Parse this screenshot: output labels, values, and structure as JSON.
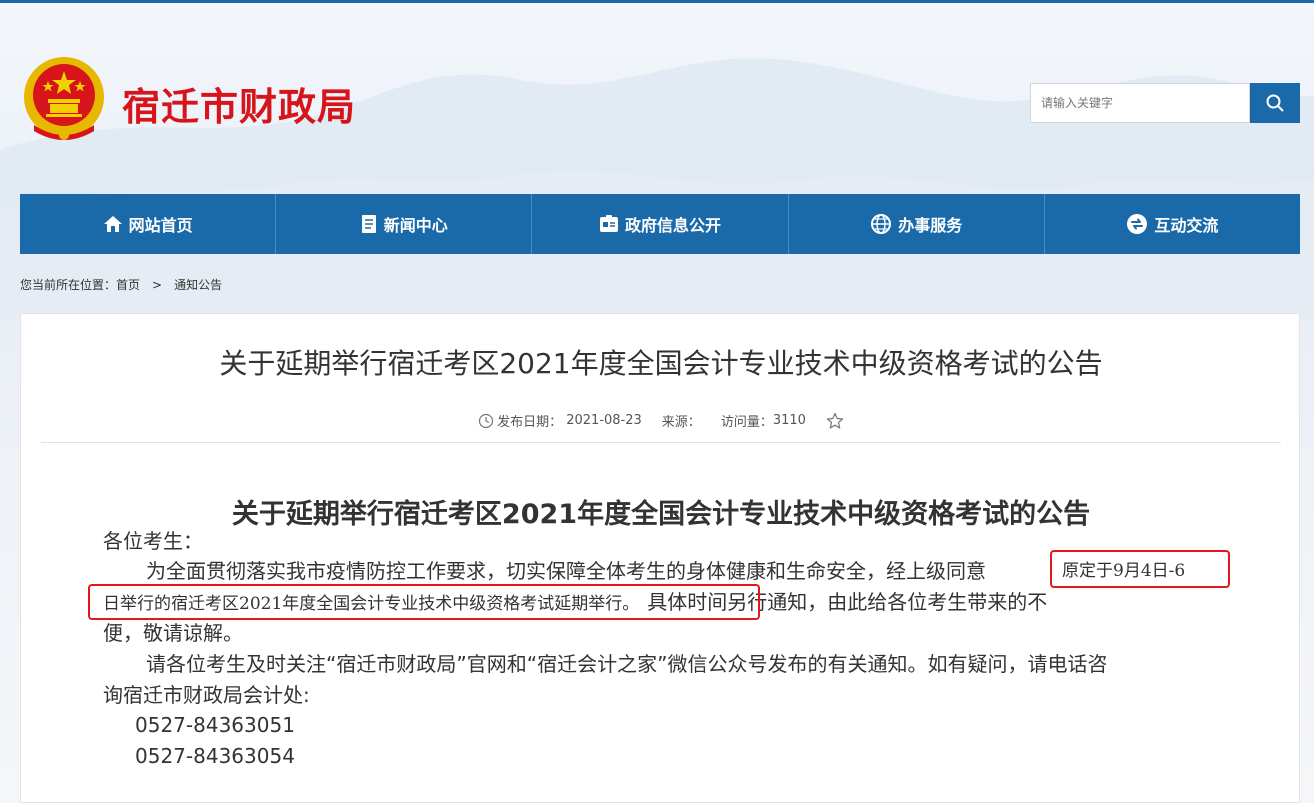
{
  "header": {
    "site_title": "宿迁市财政局",
    "search": {
      "placeholder": "请输入关键字"
    }
  },
  "nav": {
    "items": [
      {
        "label": "网站首页",
        "icon": "home-icon"
      },
      {
        "label": "新闻中心",
        "icon": "news-icon"
      },
      {
        "label": "政府信息公开",
        "icon": "info-disclosure-icon"
      },
      {
        "label": "办事服务",
        "icon": "globe-icon"
      },
      {
        "label": "互动交流",
        "icon": "interaction-icon"
      }
    ]
  },
  "breadcrumb": {
    "prefix": "您当前所在位置：",
    "home": "首页",
    "separator": ">",
    "current": "通知公告"
  },
  "article": {
    "title": "关于延期举行宿迁考区2021年度全国会计专业技术中级资格考试的公告",
    "meta": {
      "date_label": "发布日期：",
      "date": "2021-08-23",
      "source_label": "来源：",
      "visits_label": "访问量：",
      "visits": "3110"
    },
    "body_title": "关于延期举行宿迁考区2021年度全国会计专业技术中级资格考试的公告",
    "greeting": "各位考生：",
    "p1_line1_a": "为全面贯彻落实我市疫情防控工作要求，切实保障全体考生的身体健康和生命安全，经上级同意",
    "p1_line1_b": "原定于9月4日-6",
    "p1_line2_a": "日举行的宿迁考区2021年度全国会计专业技术中级资格考试延期举行。",
    "p1_line2_b": "具体时间另行通知，由此给各位考生带来的不",
    "p1_line3": "便，敬请谅解。",
    "p2_line1": "请各位考生及时关注“宿迁市财政局”官网和“宿迁会计之家”微信公众号发布的有关通知。如有疑问，请电话咨",
    "p2_line2": "询宿迁市财政局会计处:",
    "phone1": "0527-84363051",
    "phone2": "0527-84363054"
  },
  "colors": {
    "brand_blue": "#1a6aaa",
    "title_red": "#d6141a",
    "highlight_red": "#e0191e"
  }
}
